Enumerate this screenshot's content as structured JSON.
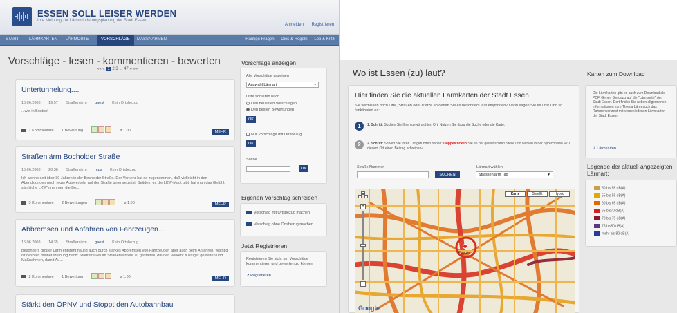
{
  "left": {
    "site_title": "ESSEN SOLL LEISER WERDEN",
    "site_subtitle": "Ihre Meinung zur Lärmminderungsplanung der Stadt Essen",
    "top_links": [
      "Anmelden",
      "Registrieren"
    ],
    "nav": [
      "START",
      "LÄRMKARTEN",
      "LÄRMORTE",
      "VORSCHLÄGE",
      "MASSNAHMEN"
    ],
    "nav_active_index": 3,
    "nav_right": [
      "Häufige Fragen",
      "Dies & Regeln",
      "Lob & Kritik"
    ],
    "page_title": "Vorschläge - lesen - kommentieren - bewerten",
    "pager": {
      "prev": "«« «",
      "pages": [
        "1",
        "2",
        "3",
        "...",
        "47"
      ],
      "current": "1",
      "next": "» »»"
    },
    "posts": [
      {
        "title": "Untertunnelung....",
        "date": "15.06.2008",
        "time": "19:57",
        "category": "Straßenlärm",
        "user": "guest",
        "ref": "Kein Ortsbezug",
        "body": "...wie in Boston!",
        "comments": "1 Kommentare",
        "ratings": "1 Bewertung",
        "avg": "ø 1.00",
        "more": "MEHR"
      },
      {
        "title": "Straßenlärm Bocholder Straße",
        "date": "15.06.2008",
        "time": "20:36",
        "category": "Straßenlärm",
        "user": "mps",
        "ref": "Kein Ortsbezug",
        "body": "Ich wohne seit über 30 Jahren in der Bocholder Straße. Der Verkehr hat so zugenommen, daß vielleicht in den Abendstunden noch reger Autoverkehr auf der Straße unterwegs ist. Seitdem es die LKW-Maut gibt, hat man das Gefühl, sämtliche LKW's nehmen die Bo...",
        "comments": "3 Kommentare",
        "ratings": "2 Bewertungen",
        "avg": "ø 1.00",
        "more": "MEHR"
      },
      {
        "title": "Abbremsen und Anfahren von Fahrzeugen...",
        "date": "15.06.2008",
        "time": "14:35",
        "category": "Straßenlärm",
        "user": "guest",
        "ref": "Kein Ortsbezug",
        "body": "Besonders großer Lärm entsteht häufig auch durch starkes Abbremsen von Fahrzeugen aber auch beim Anfahren. Wichtig ist deshalb meiner Meinung nach: Stadtstraßen im Straßenverkehr zu gestalten, die den Verkehr flüssiger gestalten und Maßnahmen, damit Au...",
        "comments": "2 Kommentare",
        "ratings": "1 Bewertung",
        "avg": "ø 1.00",
        "more": "MEHR"
      },
      {
        "title": "Stärkt den ÖPNV und Stoppt den Autobahnbau"
      }
    ],
    "sidebar": {
      "show_title": "Vorschläge anzeigen",
      "all_label": "Alle Vorschläge anzeigen",
      "select_value": "Auswahl Lärmart",
      "sort_label": "Liste sortieren nach",
      "sort_newest": "Den neuesten Vorschlägen",
      "sort_best": "Den besten Bewertungen",
      "ok": "OK",
      "only_local": "Nur Vorschläge mit Ortsbezug",
      "search_label": "Suche",
      "write_title": "Eigenen Vorschlag schreiben",
      "write_with": "Vorschlag mit Ortsbezug machen",
      "write_without": "Vorschlag ohne Ortsbezug machen",
      "register_title": "Jetzt Registrieren",
      "register_text": "Registrieren Sie sich, um Vorschläge kommentieren und bewerten zu können",
      "register_link": "Registrieren"
    }
  },
  "right": {
    "title": "Wo ist Essen (zu) laut?",
    "panel_title": "Hier finden Sie die aktuellen Lärmkarten der Stadt Essen",
    "intro": "Sie vermissen noch Orte, Straßen oder Plätze an denen Sie es besonders laut empfinden? Dann sagen Sie es uns! Und so funktioniert es:",
    "step1_label": "1. Schritt:",
    "step1": "Suchen Sie Ihren gewünschten Ort. Nutzen Sie dazu die Suche oder die Karte.",
    "step2_label": "2. Schritt:",
    "step2_pre": "Sobald Sie Ihren Ort gefunden haben:",
    "step2_red": "Doppelklicken",
    "step2_post": "Sie an der gewünschten Stelle und wählen in der Sprechblase »Zu diesem Ort einen Beitrag schreiben«.",
    "street_label": "Straße Nummer",
    "layer_label": "Lärmart wählen",
    "search_button": "SUCHEN",
    "layer_value": "Strassenlärm Tag",
    "map_types": [
      "Karte",
      "Satellit",
      "Hybrid"
    ],
    "map_city": "Essen",
    "map_brand": "Google",
    "download_title": "Karten zum Download",
    "download_text": "Die Lärmkarten gibt es auch zum Download als PDF. Gehen Sie dazu auf die \"Lärmseite\" der Stadt Essen. Dort finden Sie neben allgemeinen Informationen zum Thema Lärm auch das Rahmenkonzept mit verschiedenen Lärmkarten der Stadt Essen.",
    "download_link": "Lärmkarten",
    "legend_title": "Legende der aktuell angezeigten Lärmart:",
    "legend": [
      {
        "label": "50 bis 55 dB(A)",
        "color": "#c8a04a"
      },
      {
        "label": "55 bis 55 dB(A)",
        "color": "#e0a800"
      },
      {
        "label": "60 bis 65 dB(A)",
        "color": "#e06800"
      },
      {
        "label": "65 bis70 dB(A)",
        "color": "#d32020"
      },
      {
        "label": "70 bis 75 dB(A)",
        "color": "#8a1a2a"
      },
      {
        "label": "75 bis80 dB(A)",
        "color": "#5a3a7a"
      },
      {
        "label": "mehr als 80 dB(A)",
        "color": "#2a3a9a"
      }
    ]
  }
}
